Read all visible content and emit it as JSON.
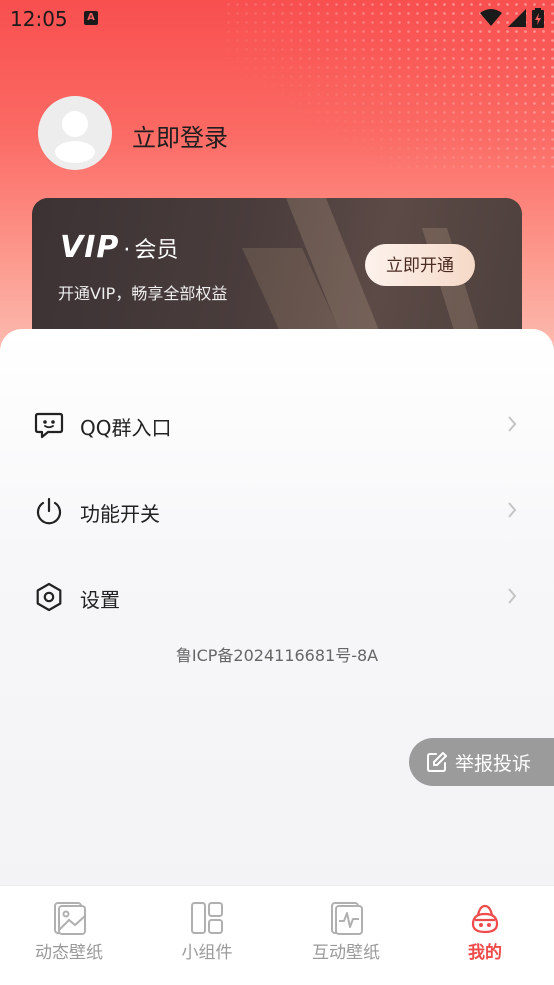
{
  "status_bar": {
    "time": "12:05",
    "notification_letter": "A"
  },
  "profile": {
    "login_label": "立即登录"
  },
  "vip_card": {
    "title_main": "VIP",
    "title_dot": "·",
    "title_suffix": "会员",
    "subtitle": "开通VIP，畅享全部权益",
    "cta_label": "立即开通"
  },
  "menu": {
    "items": [
      {
        "label": "QQ群入口",
        "icon": "qq-chat-icon"
      },
      {
        "label": "功能开关",
        "icon": "power-icon"
      },
      {
        "label": "设置",
        "icon": "settings-hexagon-icon"
      }
    ],
    "icp": "鲁ICP备2024116681号-8A"
  },
  "report_button": {
    "label": "举报投诉"
  },
  "tabbar": {
    "tabs": [
      {
        "label": "动态壁纸",
        "icon": "live-wallpaper-icon",
        "active": false
      },
      {
        "label": "小组件",
        "icon": "widget-icon",
        "active": false
      },
      {
        "label": "互动壁纸",
        "icon": "interactive-wallpaper-icon",
        "active": false
      },
      {
        "label": "我的",
        "icon": "mine-icon",
        "active": true
      }
    ],
    "active_color": "#ef4b4b",
    "inactive_color": "#9a9a9a"
  },
  "colors": {
    "hero_top": "#f84f4f",
    "hero_bottom": "#fdc5bb",
    "vip_card": "#3c3234"
  }
}
